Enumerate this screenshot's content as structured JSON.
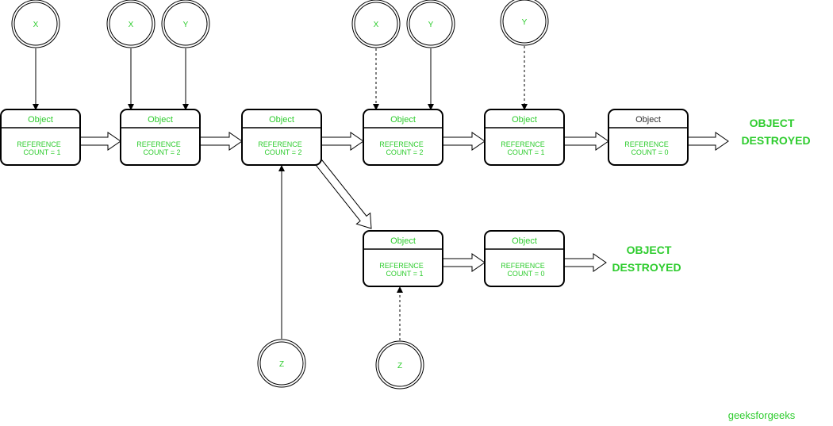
{
  "colors": {
    "accent": "#2ecc2e",
    "stroke": "#000000",
    "dark_text": "#333333"
  },
  "objects": [
    {
      "title": "Object",
      "line1": "REFERENCE",
      "line2": "COUNT = 1",
      "title_color": "green"
    },
    {
      "title": "Object",
      "line1": "REFERENCE",
      "line2": "COUNT = 2",
      "title_color": "green"
    },
    {
      "title": "Object",
      "line1": "REFERENCE",
      "line2": "COUNT = 2",
      "title_color": "green"
    },
    {
      "title": "Object",
      "line1": "REFERENCE",
      "line2": "COUNT = 2",
      "title_color": "green"
    },
    {
      "title": "Object",
      "line1": "REFERENCE",
      "line2": "COUNT = 1",
      "title_color": "green"
    },
    {
      "title": "Object",
      "line1": "REFERENCE",
      "line2": "COUNT = 0",
      "title_color": "dark"
    },
    {
      "title": "Object",
      "line1": "REFERENCE",
      "line2": "COUNT = 1",
      "title_color": "green"
    },
    {
      "title": "Object",
      "line1": "REFERENCE",
      "line2": "COUNT = 0",
      "title_color": "green"
    }
  ],
  "references": [
    {
      "label": "X",
      "target": 0,
      "style": "solid"
    },
    {
      "label": "X",
      "target": 1,
      "style": "solid"
    },
    {
      "label": "Y",
      "target": 1,
      "style": "solid"
    },
    {
      "label": "X",
      "target": 3,
      "style": "dashed"
    },
    {
      "label": "Y",
      "target": 3,
      "style": "solid"
    },
    {
      "label": "Y",
      "target": 4,
      "style": "dashed"
    },
    {
      "label": "Z",
      "target": 2,
      "style": "solid"
    },
    {
      "label": "Z",
      "target": 6,
      "style": "dashed"
    }
  ],
  "destroyed": [
    {
      "line1": "OBJECT",
      "line2": "DESTROYED"
    },
    {
      "line1": "OBJECT",
      "line2": "DESTROYED"
    }
  ],
  "watermark": "geeksforgeeks"
}
